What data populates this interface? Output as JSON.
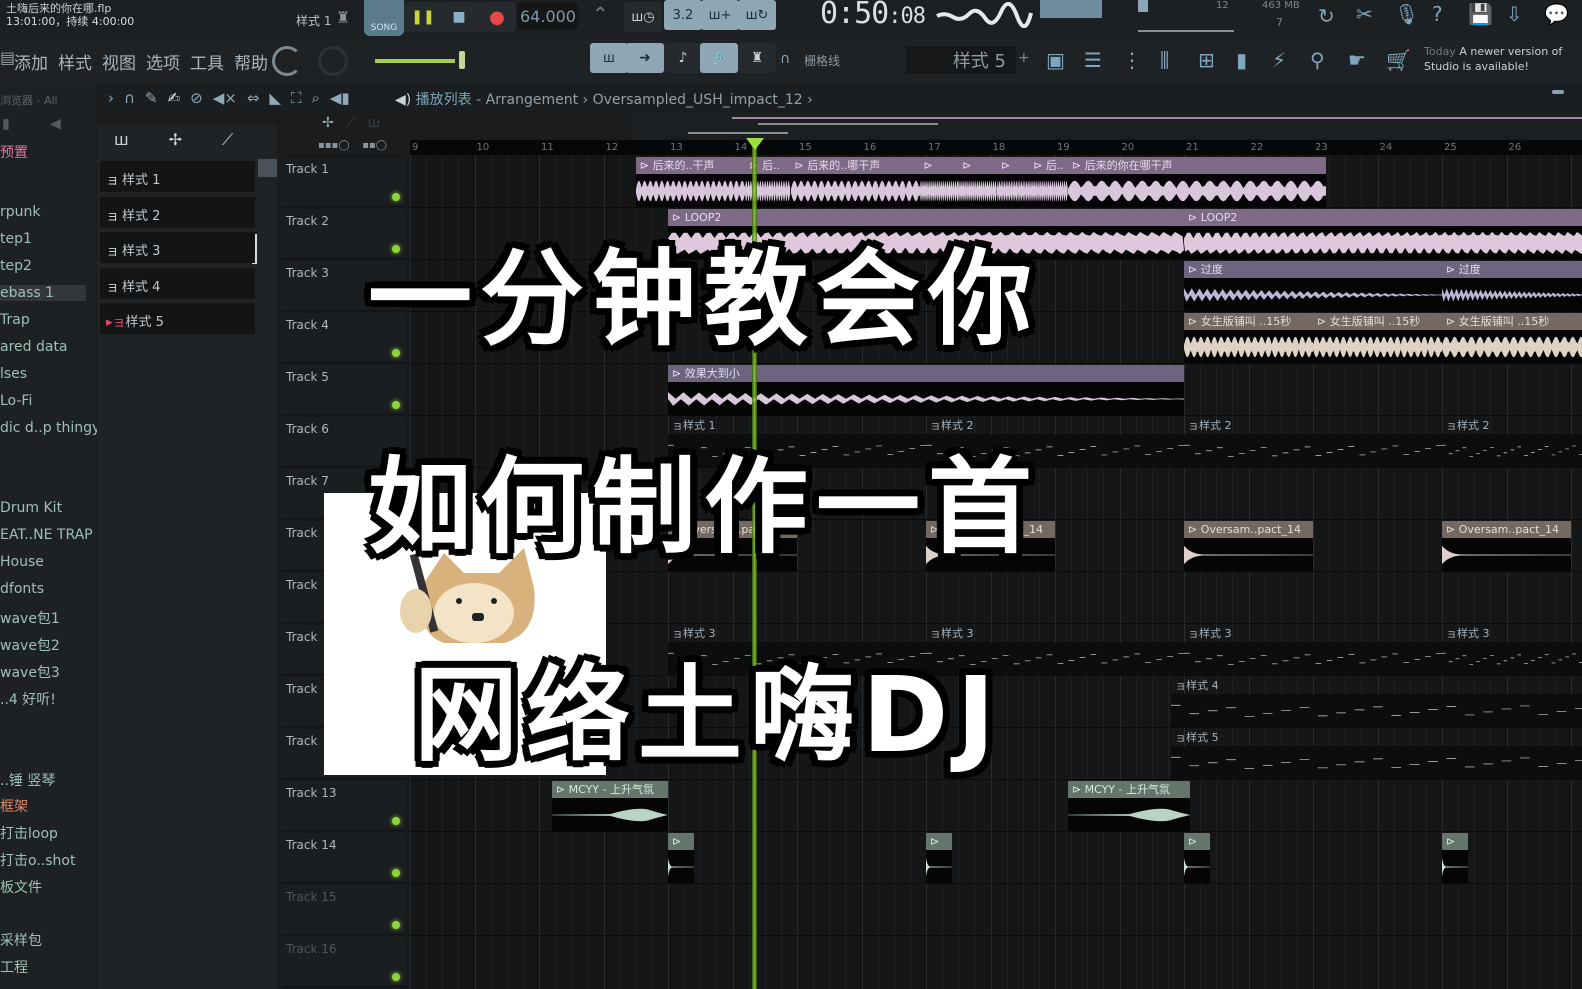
{
  "project": {
    "file_name": "土嗨后来的你在哪.flp",
    "position": "13:01:00，持续 4:00:00",
    "current_pattern": "样式 1"
  },
  "transport": {
    "pat_song_label": "SONG",
    "tempo": "64.000",
    "time_main": "0:50",
    "time_sub": ":08",
    "cpu_label": "12",
    "memory": "463 MB",
    "polyphony": "7"
  },
  "menu": [
    "添加",
    "样式",
    "视图",
    "选项",
    "工具",
    "帮助"
  ],
  "toolbar": {
    "snap_label": "栅格线",
    "pattern_selector": "样式 5",
    "news_today": "Today",
    "news_text": "A newer version of",
    "news_text2": "Studio is available!"
  },
  "browser": {
    "header": "浏览器 - All",
    "items": [
      {
        "label": "预置",
        "style": "pink"
      },
      {
        "label": "rpunk",
        "style": ""
      },
      {
        "label": "tep1",
        "style": ""
      },
      {
        "label": "tep2",
        "style": ""
      },
      {
        "label": "ebass 1",
        "style": "sel"
      },
      {
        "label": "Trap",
        "style": ""
      },
      {
        "label": "ared data",
        "style": ""
      },
      {
        "label": "lses",
        "style": ""
      },
      {
        "label": "Lo-Fi",
        "style": ""
      },
      {
        "label": "dic d..p thingy",
        "style": ""
      },
      {
        "label": "Drum Kit",
        "style": ""
      },
      {
        "label": "EAT..NE TRAP",
        "style": ""
      },
      {
        "label": "House",
        "style": ""
      },
      {
        "label": "dfonts",
        "style": ""
      },
      {
        "label": "wave包1",
        "style": ""
      },
      {
        "label": "wave包2",
        "style": ""
      },
      {
        "label": "wave包3",
        "style": ""
      },
      {
        "label": "..4 好听!",
        "style": ""
      },
      {
        "label": "..锤 竖琴",
        "style": ""
      },
      {
        "label": "框架",
        "style": "orange"
      },
      {
        "label": "打击loop",
        "style": ""
      },
      {
        "label": "打击o..shot",
        "style": ""
      },
      {
        "label": "板文件",
        "style": ""
      },
      {
        "label": "采样包",
        "style": ""
      },
      {
        "label": "工程",
        "style": ""
      }
    ]
  },
  "patterns": [
    "样式 1",
    "样式 2",
    "样式 3",
    "样式 4",
    "样式 5"
  ],
  "breadcrumb": {
    "root": "播放列表",
    "sep": "›",
    "part1": "Arrangement",
    "part2": "Oversampled_USH_impact_12"
  },
  "ruler": [
    "9",
    "10",
    "11",
    "12",
    "13",
    "14",
    "15",
    "16",
    "17",
    "18",
    "19",
    "20",
    "21",
    "22",
    "23",
    "24",
    "25",
    "26"
  ],
  "tracks": [
    "Track 1",
    "Track 2",
    "Track 3",
    "Track 4",
    "Track 5",
    "Track 6",
    "Track 7",
    "Track",
    "Track",
    "Track",
    "Track",
    "Track",
    "Track 13",
    "Track 14",
    "Track 15",
    "Track 16"
  ],
  "clips": {
    "vocal": [
      "后来的..干声",
      "后..",
      "后来的..哪干声",
      "",
      "",
      "",
      "后..",
      "后来的你在哪干声"
    ],
    "loop": "LOOP2",
    "transition": "过度",
    "female": "女生版铺叫 ..15秒",
    "effect": "效果大到小",
    "pattern1": "样式 1",
    "pattern2": "样式 2",
    "pattern3": "样式 3",
    "pattern4": "样式 4",
    "pattern5": "样式 5",
    "impact": "Oversam..pact_14",
    "riser": "MCYY - 上升气氛"
  },
  "overlay": {
    "line1": "一分钟教会你",
    "line2": "如何制作一首",
    "line3": "网络土嗨DJ"
  }
}
